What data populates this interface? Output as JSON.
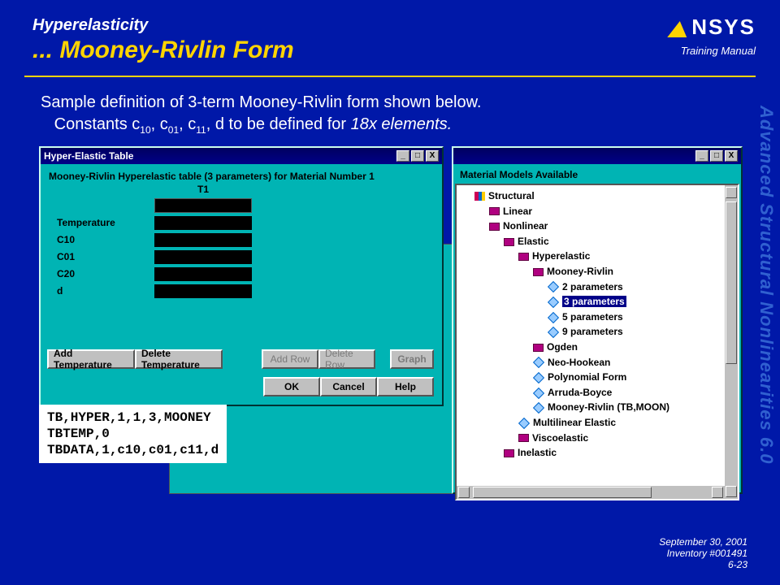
{
  "header": {
    "pretitle": "Hyperelasticity",
    "title": "... Mooney-Rivlin Form",
    "logo_text": "NSYS",
    "training": "Training Manual"
  },
  "body": {
    "line1a": "Sample definition of 3-term Mooney-Rivlin form shown below.",
    "line2a": "Constants c",
    "c10s": "10",
    "sep1": ", c",
    "c01s": "01",
    "sep2": ", c",
    "c11s": "11",
    "line2b_rest": ", d to be defined for ",
    "elem": "18x elements.",
    "end": ""
  },
  "dialog_left": {
    "title": "Hyper-Elastic Table",
    "subtitle": "Mooney-Rivlin Hyperelastic table (3 parameters) for Material Number 1",
    "col": "T1",
    "rows": [
      "Temperature",
      "C10",
      "C01",
      "C20",
      "d"
    ],
    "buttons": {
      "add_temp": "Add Temperature",
      "del_temp": "Delete Temperature",
      "add_row": "Add Row",
      "del_row": "Delete Row",
      "graph": "Graph",
      "ok": "OK",
      "cancel": "Cancel",
      "help": "Help"
    }
  },
  "dialog_right": {
    "heading": "Material Models Available",
    "tree": {
      "root": "Structural",
      "linear": "Linear",
      "nonlinear": "Nonlinear",
      "elastic": "Elastic",
      "hyperelastic": "Hyperelastic",
      "mooney": "Mooney-Rivlin",
      "p2": "2 parameters",
      "p3": "3 parameters",
      "p5": "5 parameters",
      "p9": "9 parameters",
      "ogden": "Ogden",
      "neo": "Neo-Hookean",
      "poly": "Polynomial Form",
      "ab": "Arruda-Boyce",
      "mrmoon": "Mooney-Rivlin (TB,MOON)",
      "multi": "Multilinear Elastic",
      "visco": "Viscoelastic",
      "inelastic": "Inelastic"
    }
  },
  "code": {
    "l1": "TB,HYPER,1,1,3,MOONEY",
    "l2": "TBTEMP,0",
    "l3": "TBDATA,1,c10,c01,c11,d"
  },
  "side_label": "Advanced Structural Nonlinearities 6.0",
  "footer": {
    "date": "September 30, 2001",
    "inv": "Inventory #001491",
    "page": "6-23"
  },
  "win_icons": {
    "min": "_",
    "max": "□",
    "close": "X"
  }
}
